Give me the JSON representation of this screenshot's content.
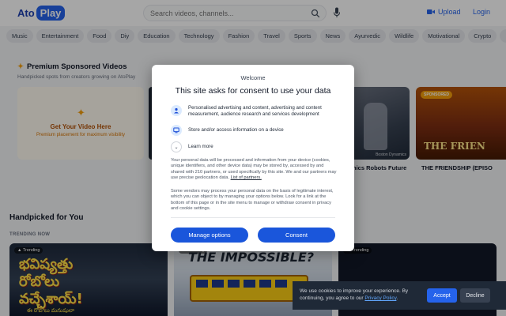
{
  "header": {
    "logo_ato": "Ato",
    "logo_play": "Play",
    "search_placeholder": "Search videos, channels...",
    "upload_label": "Upload",
    "login_label": "Login"
  },
  "categories": [
    "Music",
    "Entertainment",
    "Food",
    "Diy",
    "Education",
    "Technology",
    "Fashion",
    "Travel",
    "Sports",
    "News",
    "Ayurvedic",
    "Wildlife",
    "Motivational",
    "Crypto",
    "In"
  ],
  "premium": {
    "title": "Premium Sponsored Videos",
    "subtitle": "Handpicked spots from creators growing on AtoPlay",
    "ad_title": "Get Your Video Here",
    "ad_sub": "Premium placement for maximum visibility",
    "robot_title": "nics Robots Future",
    "robot_label": "Boston Dynamics",
    "friend_badge": "SPONSORED",
    "friend_title": "THE FRIENDSHIP (EPISO",
    "friend_big": "THE FRIEN"
  },
  "handpicked": {
    "title": "Handpicked for You",
    "trending_label": "TRENDING NOW",
    "cards": [
      {
        "pill": "Trending",
        "line1": "భవిష్యత్తు",
        "line2": "రోబోలు",
        "line3": "వచ్చేశాయ్!",
        "line4": "ఈ రోబోలు మనుషులా"
      },
      {
        "pill": "Trending",
        "overlay": "THE IMPOSSIBLE?"
      },
      {
        "pill": "Trending"
      }
    ]
  },
  "consent": {
    "welcome": "Welcome",
    "title": "This site asks for consent to use your data",
    "item1": "Personalised advertising and content, advertising and content measurement, audience research and services development",
    "item2": "Store and/or access information on a device",
    "learn_more": "Learn more",
    "para1": "Your personal data will be processed and information from your device (cookies, unique identifiers, and other device data) may be stored by, accessed by and shared with 210 partners, or used specifically by this site. We and our partners may use precise geolocation data.",
    "para1_link": "List of partners.",
    "para2": "Some vendors may process your personal data on the basis of legitimate interest, which you can object to by managing your options below. Look for a link at the bottom of this page or in the site menu to manage or withdraw consent in privacy and cookie settings.",
    "manage_btn": "Manage options",
    "consent_btn": "Consent"
  },
  "cookie": {
    "text": "We use cookies to improve your experience. By continuing, you agree to our",
    "link": "Privacy Policy",
    "end": ".",
    "accept": "Accept",
    "decline": "Decline"
  },
  "colors": {
    "brand": "#2563eb",
    "consent_button": "#1a56db",
    "premium_accent": "#f59e0b"
  }
}
